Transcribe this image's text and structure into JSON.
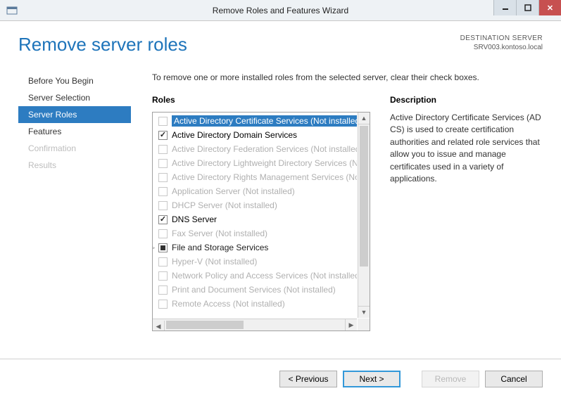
{
  "window": {
    "title": "Remove Roles and Features Wizard"
  },
  "header": {
    "page_title": "Remove server roles",
    "dest_label": "DESTINATION SERVER",
    "dest_value": "SRV003.kontoso.local"
  },
  "sidebar": {
    "items": [
      {
        "label": "Before You Begin",
        "state": "normal"
      },
      {
        "label": "Server Selection",
        "state": "normal"
      },
      {
        "label": "Server Roles",
        "state": "active"
      },
      {
        "label": "Features",
        "state": "normal"
      },
      {
        "label": "Confirmation",
        "state": "disabled"
      },
      {
        "label": "Results",
        "state": "disabled"
      }
    ]
  },
  "content": {
    "instruction": "To remove one or more installed roles from the selected server, clear their check boxes.",
    "roles_heading": "Roles",
    "desc_heading": "Description",
    "roles": [
      {
        "label": "Active Directory Certificate Services (Not installed)",
        "checked": false,
        "disabled": true,
        "selected": true
      },
      {
        "label": "Active Directory Domain Services",
        "checked": true,
        "disabled": false
      },
      {
        "label": "Active Directory Federation Services (Not installed)",
        "checked": false,
        "disabled": true
      },
      {
        "label": "Active Directory Lightweight Directory Services (Not installed)",
        "checked": false,
        "disabled": true
      },
      {
        "label": "Active Directory Rights Management Services (Not installed)",
        "checked": false,
        "disabled": true
      },
      {
        "label": "Application Server (Not installed)",
        "checked": false,
        "disabled": true
      },
      {
        "label": "DHCP Server (Not installed)",
        "checked": false,
        "disabled": true
      },
      {
        "label": "DNS Server",
        "checked": true,
        "disabled": false
      },
      {
        "label": "Fax Server (Not installed)",
        "checked": false,
        "disabled": true
      },
      {
        "label": "File and Storage Services",
        "checked": "partial",
        "disabled": false,
        "expandable": true,
        "bold": true
      },
      {
        "label": "Hyper-V (Not installed)",
        "checked": false,
        "disabled": true
      },
      {
        "label": "Network Policy and Access Services (Not installed)",
        "checked": false,
        "disabled": true
      },
      {
        "label": "Print and Document Services (Not installed)",
        "checked": false,
        "disabled": true
      },
      {
        "label": "Remote Access (Not installed)",
        "checked": false,
        "disabled": true
      }
    ],
    "description_text": "Active Directory Certificate Services (AD CS) is used to create certification authorities and related role services that allow you to issue and manage certificates used in a variety of applications."
  },
  "buttons": {
    "previous": "< Previous",
    "next": "Next >",
    "remove": "Remove",
    "cancel": "Cancel"
  }
}
